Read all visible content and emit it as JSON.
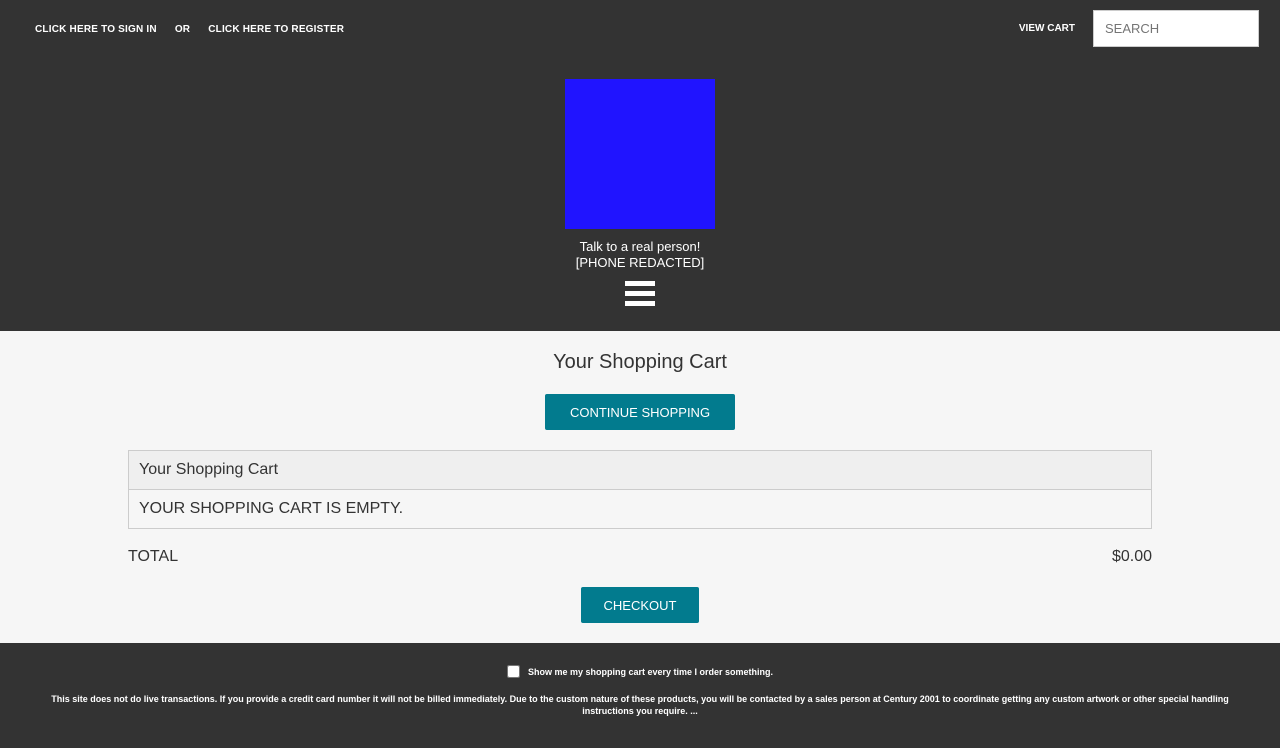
{
  "topbar": {
    "sign_in": "CLICK HERE TO SIGN IN",
    "or": "OR",
    "register": "CLICK HERE TO REGISTER",
    "view_cart": "VIEW CART",
    "search_placeholder": "SEARCH"
  },
  "header": {
    "logo_color": "#2014ff",
    "contact_line1": "Talk to a real person!",
    "contact_line2": "[PHONE REDACTED]",
    "menu_icon": "hamburger-menu-icon"
  },
  "main": {
    "title": "Your Shopping Cart",
    "continue_label": "CONTINUE SHOPPING",
    "table_header": "Your Shopping Cart",
    "empty_message": "YOUR SHOPPING CART IS EMPTY.",
    "total_label": "TOTAL",
    "total_value": "$0.00",
    "checkout_label": "CHECKOUT"
  },
  "footer": {
    "show_cart_label": "Show me my shopping cart every time I order something.",
    "show_cart_checked": false,
    "disclaimer": "This site does not do live transactions. If you provide a credit card number it will not be billed immediately. Due to the custom nature of these products, you will be contacted by a sales person at Century 2001 to coordinate getting any custom artwork or other special handling instructions you require. ..."
  },
  "colors": {
    "header_bg": "#333333",
    "button_bg": "#027b8e",
    "page_bg": "#f6f6f6"
  }
}
